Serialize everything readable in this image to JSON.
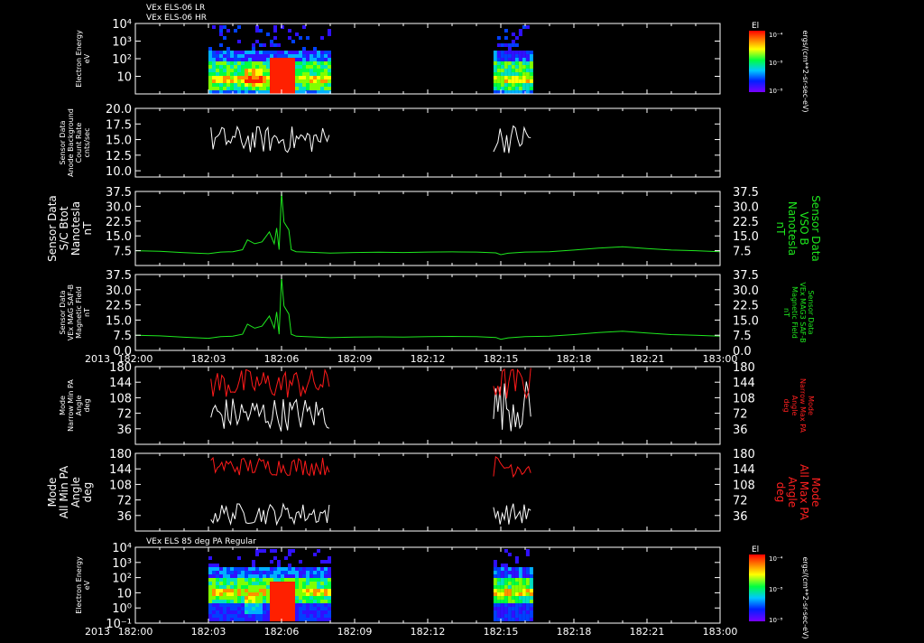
{
  "chart_data": [
    {
      "type": "heatmap",
      "name": "panel-1",
      "header_lines": [
        "VEx ELS-06 LR",
        "VEx ELS-06 HR"
      ],
      "ylabel_left": [
        "Electron Energy",
        "eV"
      ],
      "y_log": true,
      "ylim": [
        1,
        10000
      ],
      "y_ticks": [
        10,
        100,
        1000,
        10000
      ],
      "y_tick_labels": [
        "10",
        "10²",
        "10³",
        "10⁴"
      ],
      "colorbar": {
        "title": "El",
        "ticks": [
          "10⁻⁴",
          "10⁻⁸",
          "10⁻⁸"
        ]
      },
      "right_label": "ergs/(cm**2-sr-sec-eV)",
      "data_intervals": [
        [
          "182:03",
          "182:08"
        ],
        [
          "182:14.7",
          "182:16.3"
        ]
      ],
      "notes": []
    },
    {
      "type": "line",
      "name": "panel-2",
      "ylabel_left": [
        "Sensor Data",
        "Anode Background",
        "Count Rate",
        "cnts/sec"
      ],
      "ylim": [
        9,
        20
      ],
      "y_ticks": [
        10,
        12.5,
        15,
        17.5,
        20
      ],
      "y_tick_labels": [
        "10.0",
        "12.5",
        "15.0",
        "17.5",
        "20.0"
      ],
      "series": [
        {
          "color": "#ffffff",
          "segments": [
            {
              "start": 3.1,
              "end": 8.0,
              "mean": 15.0,
              "amp": 2.2
            },
            {
              "start": 14.7,
              "end": 16.3,
              "mean": 15.2,
              "amp": 2.4
            }
          ]
        }
      ]
    },
    {
      "type": "line",
      "name": "panel-3",
      "ylabel_left": [
        "Sensor Data",
        "S/C Btot",
        "Nanotesla",
        "nT"
      ],
      "ylabel_right": [
        "Sensor Data",
        "VSO B",
        "Nanotesla",
        "nT"
      ],
      "ylim": [
        0,
        37.5
      ],
      "y_ticks": [
        7.5,
        15,
        22.5,
        30,
        37.5
      ],
      "y_tick_labels": [
        "7.5",
        "15.0",
        "22.5",
        "30.0",
        "37.5"
      ],
      "series": [
        {
          "color": "#1ee81e",
          "points": [
            [
              0,
              7.5
            ],
            [
              1,
              7.2
            ],
            [
              2,
              6.5
            ],
            [
              3,
              6.0
            ],
            [
              3.5,
              6.8
            ],
            [
              4,
              7.0
            ],
            [
              4.4,
              8.0
            ],
            [
              4.6,
              13
            ],
            [
              4.9,
              11
            ],
            [
              5.2,
              12
            ],
            [
              5.5,
              17
            ],
            [
              5.7,
              11
            ],
            [
              5.8,
              19
            ],
            [
              5.9,
              8
            ],
            [
              6.0,
              37
            ],
            [
              6.1,
              22
            ],
            [
              6.3,
              18
            ],
            [
              6.4,
              8
            ],
            [
              6.6,
              7
            ],
            [
              7,
              6.8
            ],
            [
              8,
              6.3
            ],
            [
              9,
              6.6
            ],
            [
              10,
              6.7
            ],
            [
              11,
              6.6
            ],
            [
              12,
              6.8
            ],
            [
              13,
              6.9
            ],
            [
              14,
              6.8
            ],
            [
              14.8,
              6.4
            ],
            [
              15,
              5.5
            ],
            [
              15.3,
              6.2
            ],
            [
              16,
              6.8
            ],
            [
              17,
              7.0
            ],
            [
              18,
              7.8
            ],
            [
              19,
              8.8
            ],
            [
              20,
              9.5
            ],
            [
              21,
              8.6
            ],
            [
              22,
              7.8
            ],
            [
              23,
              7.5
            ],
            [
              24,
              7.0
            ]
          ]
        }
      ]
    },
    {
      "type": "line",
      "name": "panel-4",
      "ylabel_left": [
        "Sensor Data",
        "VEx MAG SAF-B",
        "Magnetic Field",
        "nT"
      ],
      "ylabel_right": [
        "Sensor Data",
        "VEx MAG3 SAF-B",
        "Magnetic Field",
        "nT"
      ],
      "ylim": [
        0,
        37.5
      ],
      "y_ticks": [
        0,
        7.5,
        15,
        22.5,
        30,
        37.5
      ],
      "y_tick_labels": [
        "0.0",
        "7.5",
        "15.0",
        "22.5",
        "30.0",
        "37.5"
      ],
      "series": [
        {
          "color": "#1ee81e",
          "points": [
            [
              0,
              7.5
            ],
            [
              1,
              7.2
            ],
            [
              2,
              6.5
            ],
            [
              3,
              6.0
            ],
            [
              3.5,
              6.8
            ],
            [
              4,
              7.0
            ],
            [
              4.4,
              8.0
            ],
            [
              4.6,
              13
            ],
            [
              4.9,
              11
            ],
            [
              5.2,
              12
            ],
            [
              5.5,
              17
            ],
            [
              5.7,
              11
            ],
            [
              5.8,
              19
            ],
            [
              5.9,
              8
            ],
            [
              6.0,
              36
            ],
            [
              6.1,
              22
            ],
            [
              6.3,
              18
            ],
            [
              6.4,
              8
            ],
            [
              6.6,
              7
            ],
            [
              7,
              6.8
            ],
            [
              8,
              6.3
            ],
            [
              9,
              6.6
            ],
            [
              10,
              6.7
            ],
            [
              11,
              6.6
            ],
            [
              12,
              6.8
            ],
            [
              13,
              6.9
            ],
            [
              14,
              6.8
            ],
            [
              14.8,
              6.4
            ],
            [
              15,
              5.5
            ],
            [
              15.3,
              6.2
            ],
            [
              16,
              6.8
            ],
            [
              17,
              7.0
            ],
            [
              18,
              7.8
            ],
            [
              19,
              8.8
            ],
            [
              20,
              9.5
            ],
            [
              21,
              8.6
            ],
            [
              22,
              7.8
            ],
            [
              23,
              7.5
            ],
            [
              24,
              7.0
            ]
          ]
        }
      ]
    },
    {
      "type": "line",
      "name": "panel-5",
      "ylabel_left": [
        "Mode",
        "Narrow Min PA",
        "Angle",
        "deg"
      ],
      "ylabel_right": [
        "Mode",
        "Narrow Max PA",
        "Angle",
        "deg"
      ],
      "ylim": [
        0,
        180
      ],
      "y_ticks": [
        36,
        72,
        108,
        144,
        180
      ],
      "y_tick_labels": [
        "36",
        "72",
        "108",
        "144",
        "180"
      ],
      "series": [
        {
          "color": "#ffffff",
          "segments": [
            {
              "start": 3.1,
              "end": 8.0,
              "mean": 70,
              "amp": 40
            },
            {
              "start": 14.7,
              "end": 16.3,
              "mean": 90,
              "amp": 60
            }
          ]
        },
        {
          "color": "#ff1a1a",
          "segments": [
            {
              "start": 3.1,
              "end": 8.0,
              "mean": 140,
              "amp": 35
            },
            {
              "start": 14.7,
              "end": 16.3,
              "mean": 140,
              "amp": 40
            }
          ]
        }
      ]
    },
    {
      "type": "line",
      "name": "panel-6",
      "ylabel_left": [
        "Mode",
        "All Min PA",
        "Angle",
        "deg"
      ],
      "ylabel_right": [
        "Mode",
        "All Max PA",
        "Angle",
        "deg"
      ],
      "ylim": [
        0,
        180
      ],
      "y_ticks": [
        36,
        72,
        108,
        144,
        180
      ],
      "y_tick_labels": [
        "36",
        "72",
        "108",
        "144",
        "180"
      ],
      "series": [
        {
          "color": "#ffffff",
          "segments": [
            {
              "start": 3.1,
              "end": 8.0,
              "mean": 40,
              "amp": 25
            },
            {
              "start": 14.7,
              "end": 16.3,
              "mean": 40,
              "amp": 25
            }
          ]
        },
        {
          "color": "#ff1a1a",
          "segments": [
            {
              "start": 3.1,
              "end": 8.0,
              "mean": 150,
              "amp": 22
            },
            {
              "start": 14.7,
              "end": 16.3,
              "mean": 150,
              "amp": 25
            }
          ]
        }
      ]
    },
    {
      "type": "heatmap",
      "name": "panel-7",
      "header_lines": [
        "VEx ELS 85 deg PA Regular"
      ],
      "ylabel_left": [
        "Electron Energy",
        "eV"
      ],
      "y_log": true,
      "ylim": [
        0.1,
        10000
      ],
      "y_ticks": [
        0.1,
        1,
        10,
        100,
        1000,
        10000
      ],
      "y_tick_labels": [
        "10⁻¹",
        "10⁰",
        "10",
        "10²",
        "10³",
        "10⁴"
      ],
      "colorbar": {
        "title": "El",
        "ticks": [
          "10⁻⁴",
          "10⁻⁸",
          "10⁻⁸"
        ]
      },
      "right_label": "ergs/(cm**2-sr-sec-eV)",
      "data_intervals": [
        [
          "182:03",
          "182:08"
        ],
        [
          "182:14.7",
          "182:16.3"
        ]
      ]
    }
  ],
  "time_axis": {
    "year_label": "2013",
    "xlim_minutes": [
      0,
      24
    ],
    "ticks": [
      0,
      3,
      6,
      9,
      12,
      15,
      18,
      21,
      24
    ],
    "tick_labels": [
      "182:00",
      "182:03",
      "182:06",
      "182:09",
      "182:12",
      "182:15",
      "182:18",
      "182:21",
      "183:00"
    ]
  }
}
